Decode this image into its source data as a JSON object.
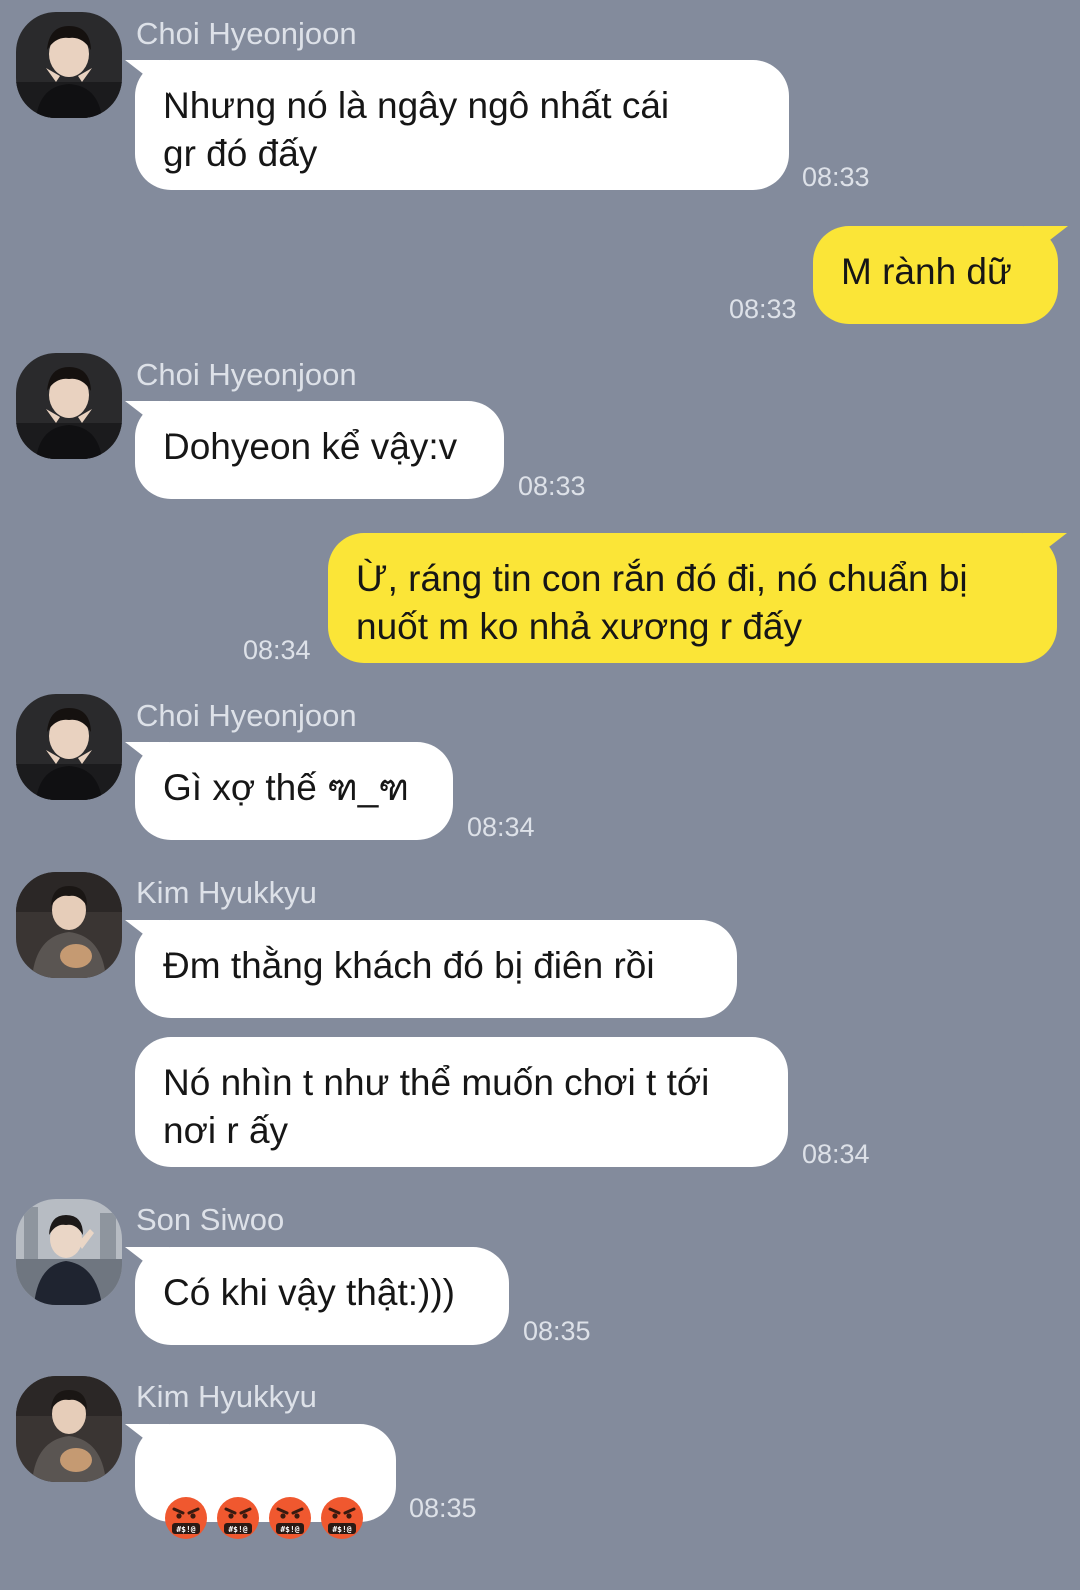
{
  "colors": {
    "background": "#838b9c",
    "incoming_bubble": "#ffffff",
    "outgoing_bubble": "#fbe537",
    "meta_text": "#dde1e8"
  },
  "messages": [
    {
      "sender": "Choi Hyeonjoon",
      "text": "Nhưng nó là ngây ngô nhất cái\ngr đó đấy",
      "time": "08:33"
    },
    {
      "sender": "me",
      "text": "M rành dữ",
      "time": "08:33"
    },
    {
      "sender": "Choi Hyeonjoon",
      "text": "Dohyeon kể vậy:v",
      "time": "08:33"
    },
    {
      "sender": "me",
      "text": "Ừ, ráng tin con rắn đó đi, nó chuẩn bị\nnuốt m ko nhả xương r đấy",
      "time": "08:34"
    },
    {
      "sender": "Choi Hyeonjoon",
      "text": "Gì xợ thế ฑ_ฑ",
      "time": "08:34"
    },
    {
      "sender": "Kim Hyukkyu",
      "text": "Đm thằng khách đó bị điên rồi"
    },
    {
      "sender": "Kim Hyukkyu",
      "text": "Nó nhìn t như thể muốn chơi t tới\nnơi r ấy",
      "time": "08:34"
    },
    {
      "sender": "Son Siwoo",
      "text": "Có khi vậy thật:)))",
      "time": "08:35"
    },
    {
      "sender": "Kim Hyukkyu",
      "emoji": [
        "face-with-symbols-on-mouth",
        "face-with-symbols-on-mouth",
        "face-with-symbols-on-mouth",
        "face-with-symbols-on-mouth"
      ],
      "emoji_glyph": "#$!@",
      "time": "08:35"
    }
  ]
}
